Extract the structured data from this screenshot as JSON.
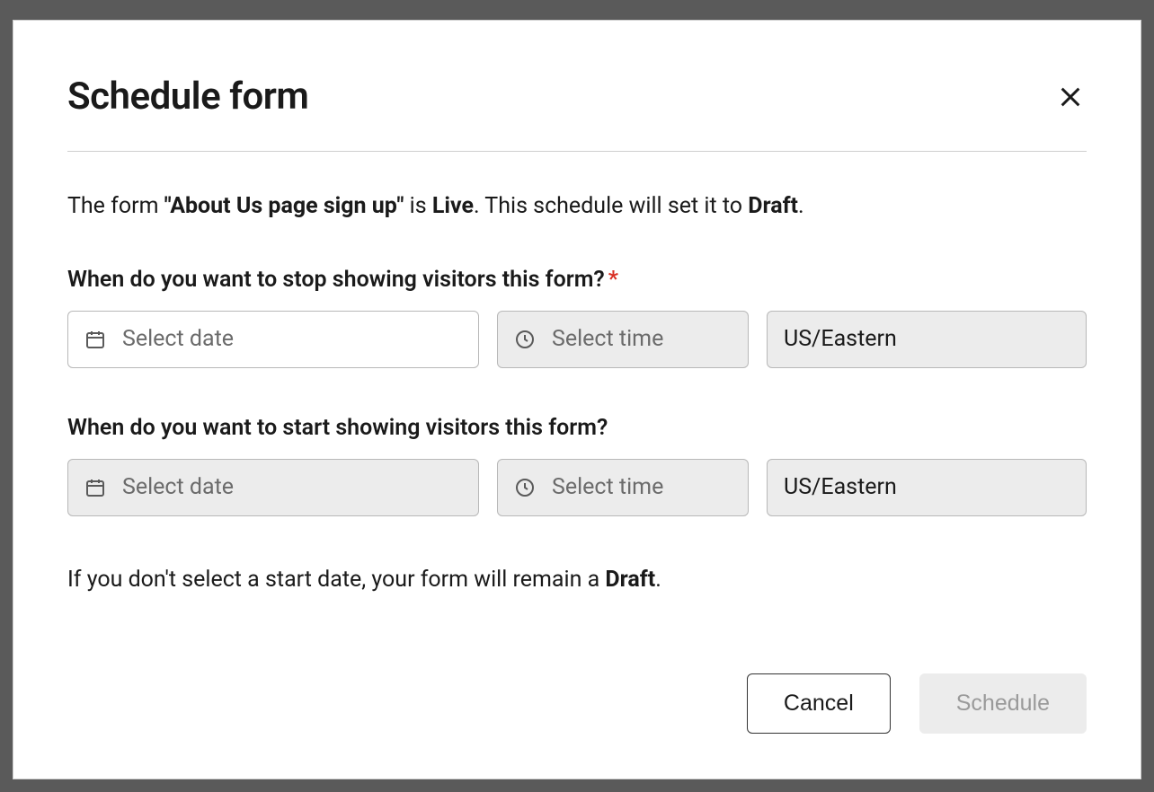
{
  "modal": {
    "title": "Schedule form",
    "description": {
      "prefix": "The form ",
      "formName": "\"About Us page sign up\"",
      "mid1": " is ",
      "status": "Live",
      "mid2": ". This schedule will set it to ",
      "targetStatus": "Draft",
      "suffix": "."
    },
    "stopSection": {
      "label": "When do you want to stop showing visitors this form?",
      "requiredMark": "*",
      "datePlaceholder": "Select date",
      "timePlaceholder": "Select time",
      "timezone": "US/Eastern"
    },
    "startSection": {
      "label": "When do you want to start showing visitors this form?",
      "datePlaceholder": "Select date",
      "timePlaceholder": "Select time",
      "timezone": "US/Eastern"
    },
    "note": {
      "prefix": "If you don't select a start date, your form will remain a ",
      "status": "Draft",
      "suffix": "."
    },
    "buttons": {
      "cancel": "Cancel",
      "schedule": "Schedule"
    }
  }
}
